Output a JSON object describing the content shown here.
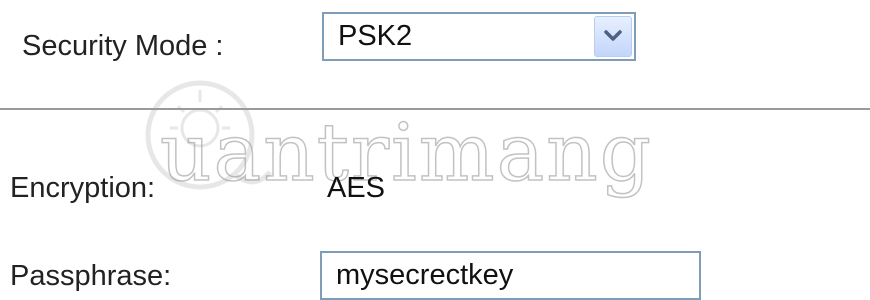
{
  "security_mode": {
    "label": "Security Mode :",
    "selected": "PSK2"
  },
  "encryption": {
    "label": "Encryption:",
    "value": "AES"
  },
  "passphrase": {
    "label": "Passphrase:",
    "value": "mysecrectkey"
  },
  "watermark": {
    "text": "uantrimang"
  },
  "colors": {
    "border": "#7f9db9",
    "arrow_button": "#c3d5fb",
    "divider": "#9a9a9a"
  }
}
